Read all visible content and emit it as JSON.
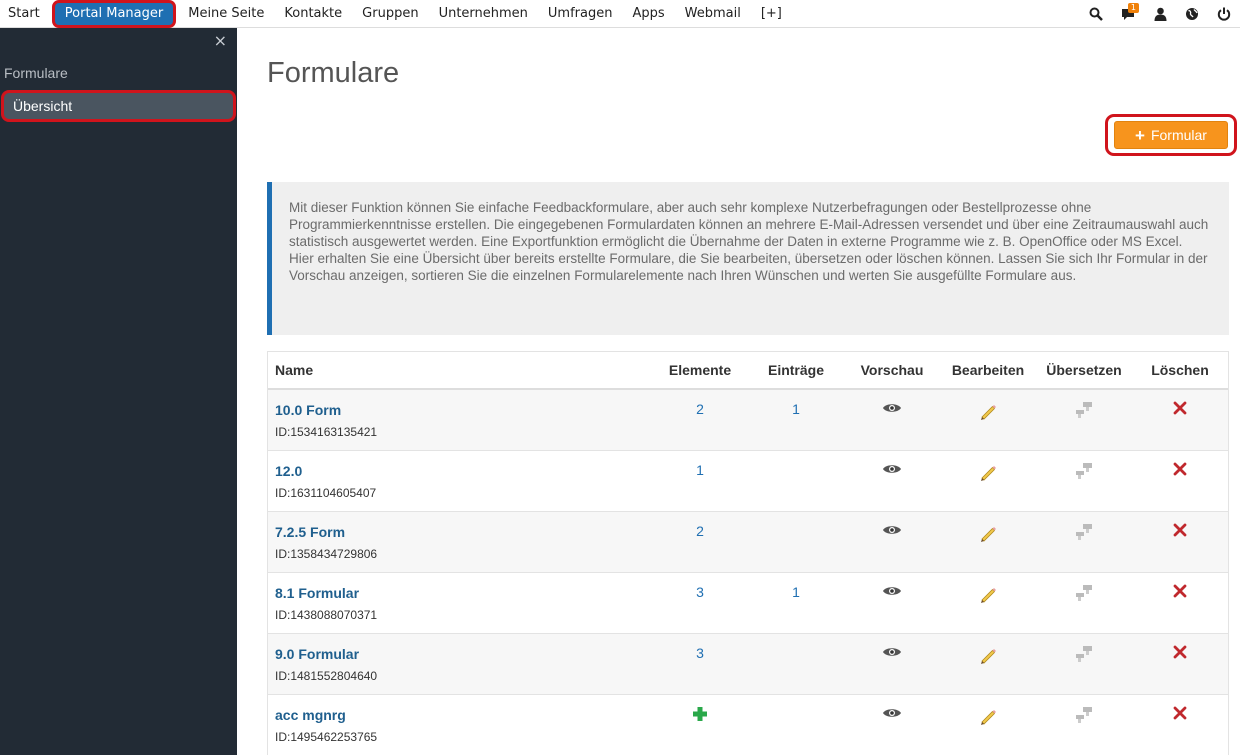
{
  "topnav": {
    "items": [
      "Start",
      "Portal Manager",
      "Meine Seite",
      "Kontakte",
      "Gruppen",
      "Unternehmen",
      "Umfragen",
      "Apps",
      "Webmail",
      "[+]"
    ],
    "notification_count": "1"
  },
  "sidebar": {
    "close": "×",
    "section_title": "Formulare",
    "items": [
      {
        "label": "Übersicht"
      }
    ]
  },
  "main": {
    "title": "Formulare",
    "add_button_label": "Formular",
    "add_button_plus": "+",
    "info_text": "Mit dieser Funktion können Sie einfache Feedbackformulare, aber auch sehr komplexe Nutzerbefragungen oder Bestellprozesse ohne Programmierkenntnisse erstellen. Die eingegebenen Formulardaten können an mehrere E-Mail-Adressen versendet und über eine Zeitraumauswahl auch statistisch ausgewertet werden. Eine Exportfunktion ermöglicht die Übernahme der Daten in externe Programme wie z. B. OpenOffice oder MS Excel.",
    "info_text_2": "Hier erhalten Sie eine Übersicht über bereits erstellte Formulare, die Sie bearbeiten, übersetzen oder löschen können. Lassen Sie sich Ihr Formular in der Vorschau anzeigen, sortieren Sie die einzelnen Formularelemente nach Ihren Wünschen und werten Sie ausgefüllte Formulare aus."
  },
  "table": {
    "columns": [
      "Name",
      "Elemente",
      "Einträge",
      "Vorschau",
      "Bearbeiten",
      "Übersetzen",
      "Löschen"
    ],
    "rows": [
      {
        "name": "10.0 Form",
        "id": "ID:1534163135421",
        "elemente": "2",
        "eintraege": "1"
      },
      {
        "name": "12.0",
        "id": "ID:1631104605407",
        "elemente": "1",
        "eintraege": ""
      },
      {
        "name": "7.2.5 Form",
        "id": "ID:1358434729806",
        "elemente": "2",
        "eintraege": ""
      },
      {
        "name": "8.1 Formular",
        "id": "ID:1438088070371",
        "elemente": "3",
        "eintraege": "1"
      },
      {
        "name": "9.0 Formular",
        "id": "ID:1481552804640",
        "elemente": "3",
        "eintraege": ""
      },
      {
        "name": "acc mgnrg",
        "id": "ID:1495462253765",
        "elemente": "",
        "eintraege": ""
      }
    ]
  },
  "colors": {
    "accent_blue": "#1f6fb2",
    "sidebar_bg": "#222b35",
    "add_button_orange": "#f7941d",
    "delete_red": "#c0282d",
    "add_element_green": "#2aa84a"
  }
}
